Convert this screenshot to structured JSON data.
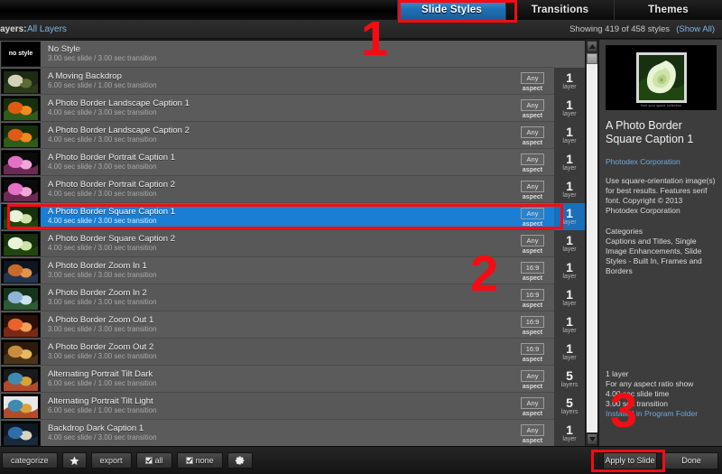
{
  "tabs": [
    {
      "label": "Slide Styles",
      "active": true
    },
    {
      "label": "Transitions",
      "active": false
    },
    {
      "label": "Themes",
      "active": false
    }
  ],
  "subbar": {
    "layers_label": "Layers:",
    "layers_value": "All Layers",
    "showing": "Showing 419 of 458 styles",
    "show_all": "(Show All)"
  },
  "list": [
    {
      "title": "No Style",
      "sub": "3.00 sec slide / 3.00 sec transition",
      "aspect": "",
      "aspect_cap": "",
      "layers": "",
      "layers_cap": "",
      "thumb": "no-style",
      "selected": false
    },
    {
      "title": "A Moving Backdrop",
      "sub": "6.00 sec slide / 1.00 sec transition",
      "aspect": "Any",
      "aspect_cap": "aspect",
      "layers": "1",
      "layers_cap": "layer",
      "thumb": "zebra",
      "selected": false
    },
    {
      "title": "A Photo Border Landscape Caption 1",
      "sub": "4.00 sec slide / 3.00 sec transition",
      "aspect": "Any",
      "aspect_cap": "aspect",
      "layers": "1",
      "layers_cap": "layer",
      "thumb": "berries",
      "selected": false
    },
    {
      "title": "A Photo Border Landscape Caption 2",
      "sub": "4.00 sec slide / 3.00 sec transition",
      "aspect": "Any",
      "aspect_cap": "aspect",
      "layers": "1",
      "layers_cap": "layer",
      "thumb": "berries",
      "selected": false
    },
    {
      "title": "A Photo Border Portrait Caption 1",
      "sub": "4.00 sec slide / 3.00 sec transition",
      "aspect": "Any",
      "aspect_cap": "aspect",
      "layers": "1",
      "layers_cap": "layer",
      "thumb": "orchid",
      "selected": false
    },
    {
      "title": "A Photo Border Portrait Caption 2",
      "sub": "4.00 sec slide / 3.00 sec transition",
      "aspect": "Any",
      "aspect_cap": "aspect",
      "layers": "1",
      "layers_cap": "layer",
      "thumb": "orchid",
      "selected": false
    },
    {
      "title": "A Photo Border Square Caption 1",
      "sub": "4.00 sec slide / 3.00 sec transition",
      "aspect": "Any",
      "aspect_cap": "aspect",
      "layers": "1",
      "layers_cap": "layer",
      "thumb": "calla",
      "selected": true
    },
    {
      "title": "A Photo Border Square Caption 2",
      "sub": "4.00 sec slide / 3.00 sec transition",
      "aspect": "Any",
      "aspect_cap": "aspect",
      "layers": "1",
      "layers_cap": "layer",
      "thumb": "calla",
      "selected": false
    },
    {
      "title": "A Photo Border Zoom In 1",
      "sub": "3.00 sec slide / 3.00 sec transition",
      "aspect": "16:9",
      "aspect_cap": "aspect",
      "layers": "1",
      "layers_cap": "layer",
      "thumb": "city",
      "selected": false
    },
    {
      "title": "A Photo Border Zoom In 2",
      "sub": "3.00 sec slide / 3.00 sec transition",
      "aspect": "16:9",
      "aspect_cap": "aspect",
      "layers": "1",
      "layers_cap": "layer",
      "thumb": "mountain",
      "selected": false
    },
    {
      "title": "A Photo Border Zoom Out 1",
      "sub": "3.00 sec slide / 3.00 sec transition",
      "aspect": "16:9",
      "aspect_cap": "aspect",
      "layers": "1",
      "layers_cap": "layer",
      "thumb": "sunset",
      "selected": false
    },
    {
      "title": "A Photo Border Zoom Out 2",
      "sub": "3.00 sec slide / 3.00 sec transition",
      "aspect": "16:9",
      "aspect_cap": "aspect",
      "layers": "1",
      "layers_cap": "layer",
      "thumb": "door",
      "selected": false
    },
    {
      "title": "Alternating Portrait Tilt Dark",
      "sub": "6.00 sec slide / 1.00 sec transition",
      "aspect": "Any",
      "aspect_cap": "aspect",
      "layers": "5",
      "layers_cap": "layers",
      "thumb": "tiltdark",
      "selected": false
    },
    {
      "title": "Alternating Portrait Tilt Light",
      "sub": "6.00 sec slide / 1.00 sec transition",
      "aspect": "Any",
      "aspect_cap": "aspect",
      "layers": "5",
      "layers_cap": "layers",
      "thumb": "tiltlight",
      "selected": false
    },
    {
      "title": "Backdrop Dark Caption 1",
      "sub": "4.00 sec slide / 3.00 sec transition",
      "aspect": "Any",
      "aspect_cap": "aspect",
      "layers": "1",
      "layers_cap": "layer",
      "thumb": "backdrop",
      "selected": false
    }
  ],
  "details": {
    "title": "A Photo Border\nSquare Caption 1",
    "title_line1": "A Photo Border",
    "title_line2": "Square Caption 1",
    "vendor": "Photodex Corporation",
    "description": "Use square-orientation image(s) for best results. Features serif font. Copyright © 2013 Photodex Corporation",
    "categories_head": "Categories",
    "categories_body": "Captions and Titles, Single Image Enhancements, Slide Styles - Built In, Frames and Borders",
    "preview_caption": "from your space collection",
    "specs": {
      "layers": "1 layer",
      "aspect": "For any aspect ratio show",
      "slide_time": "4.00 sec slide time",
      "transition": "3.00 sec transition",
      "location": "Installed in Program Folder"
    }
  },
  "toolbar": {
    "categorize": "categorize",
    "favorite_icon": "star-icon",
    "export": "export",
    "all": "all",
    "none": "none",
    "settings_icon": "gear-icon"
  },
  "actions": {
    "apply": "Apply to Slide",
    "done": "Done"
  },
  "annotations": [
    {
      "number": "1"
    },
    {
      "number": "2"
    },
    {
      "number": "3"
    }
  ],
  "colors": {
    "accent": "#1a7fd4",
    "annotation": "#f40c12",
    "link": "#6fa8dc",
    "panel": "#3d3d3d"
  }
}
